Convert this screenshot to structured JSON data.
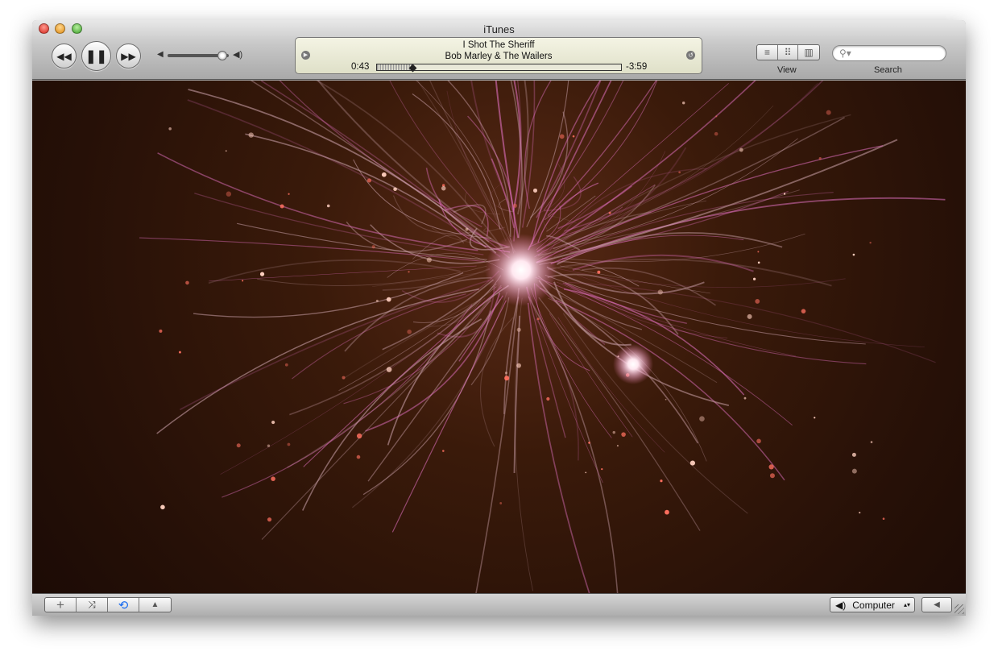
{
  "window": {
    "title": "iTunes"
  },
  "controls": {
    "previous_icon": "rewind-icon",
    "pause_icon": "pause-icon",
    "next_icon": "fast-forward-icon"
  },
  "volume": {
    "level": 0.9
  },
  "now_playing": {
    "track": "I Shot The Sheriff",
    "artist": "Bob Marley & The Wailers",
    "elapsed": "0:43",
    "remaining": "-3:59",
    "progress": 0.15
  },
  "view": {
    "label": "View",
    "options": [
      "list",
      "grid",
      "cover-flow"
    ]
  },
  "search": {
    "label": "Search",
    "placeholder": ""
  },
  "bottom": {
    "buttons": [
      "add",
      "shuffle",
      "repeat",
      "show-artwork"
    ],
    "output": "Computer",
    "repeat_color": "#1a6cf0"
  }
}
